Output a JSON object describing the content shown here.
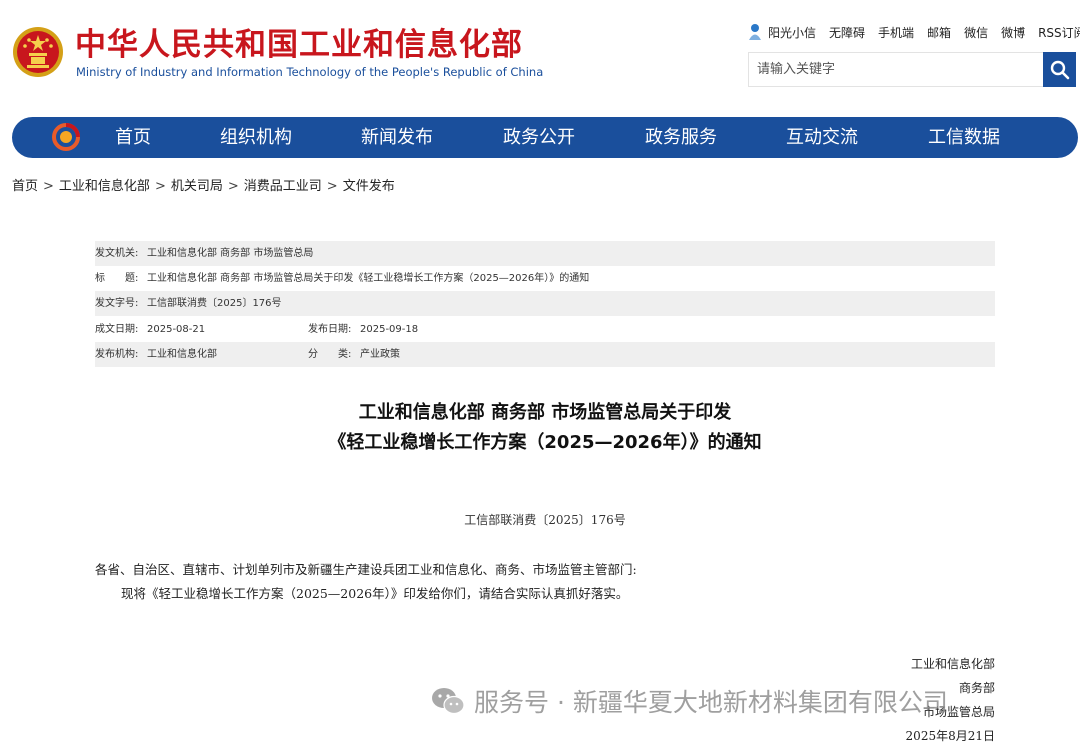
{
  "header": {
    "title": "中华人民共和国工业和信息化部",
    "subtitle": "Ministry of Industry and Information Technology of the People's Republic of China",
    "top_links": [
      "阳光小信",
      "无障碍",
      "手机端",
      "邮箱",
      "微信",
      "微博",
      "RSS订阅"
    ],
    "search_placeholder": "请输入关键字"
  },
  "nav": {
    "items": [
      "首页",
      "组织机构",
      "新闻发布",
      "政务公开",
      "政务服务",
      "互动交流",
      "工信数据"
    ]
  },
  "breadcrumb": [
    "首页",
    "工业和信息化部",
    "机关司局",
    "消费品工业司",
    "文件发布"
  ],
  "meta": {
    "issuer_label": "发文机关:",
    "issuer": "工业和信息化部 商务部 市场监管总局",
    "title_label": "标　　题:",
    "title": "工业和信息化部 商务部 市场监管总局关于印发《轻工业稳增长工作方案（2025—2026年）》的通知",
    "doc_no_label": "发文字号:",
    "doc_no": "工信部联消费〔2025〕176号",
    "created_label": "成文日期:",
    "created": "2025-08-21",
    "published_label": "发布日期:",
    "published": "2025-09-18",
    "org_label": "发布机构:",
    "org": "工业和信息化部",
    "category_label": "分　　类:",
    "category": "产业政策"
  },
  "document": {
    "title_line1": "工业和信息化部 商务部 市场监管总局关于印发",
    "title_line2": "《轻工业稳增长工作方案（2025—2026年）》的通知",
    "doc_number": "工信部联消费〔2025〕176号",
    "salutation": "各省、自治区、直辖市、计划单列市及新疆生产建设兵团工业和信息化、商务、市场监管主管部门:",
    "body": "现将《轻工业稳增长工作方案（2025—2026年）》印发给你们，请结合实际认真抓好落实。",
    "signatories": [
      "工业和信息化部",
      "商务部",
      "市场监管总局"
    ],
    "date": "2025年8月21日"
  },
  "watermark": "服务号 · 新疆华夏大地新材料集团有限公司",
  "colors": {
    "brand_red": "#c8161d",
    "nav_blue": "#1a4f9c",
    "meta_gray": "#efefef"
  }
}
